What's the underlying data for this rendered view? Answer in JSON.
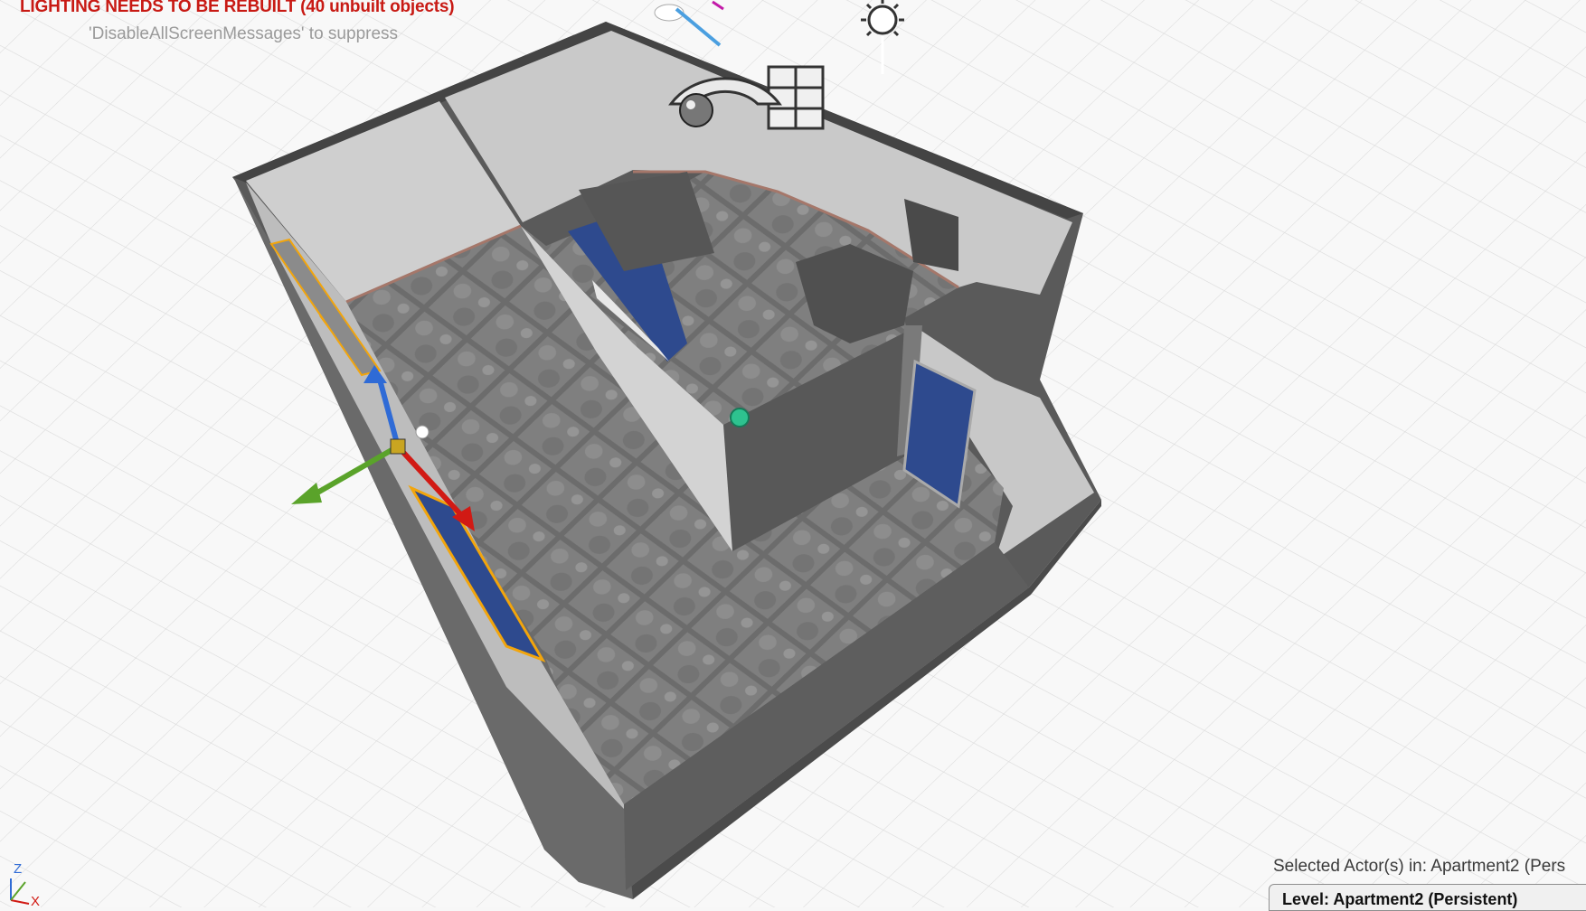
{
  "viewport": {
    "warning_message": "LIGHTING NEEDS TO BE REBUILT (40 unbuilt objects)",
    "hint_message": "'DisableAllScreenMessages' to suppress",
    "axis_labels": {
      "z": "Z",
      "x": "X"
    },
    "icons": [
      "grid-background",
      "directional-light-icon",
      "sky-sphere-icon",
      "reflection-capture-icon",
      "transform-gizmo",
      "player-start-icon"
    ],
    "colors": {
      "warning": "#c81a14",
      "selection": "#f2a50c",
      "door": "#2e4a8e",
      "gizmo_x": "#d11a14",
      "gizmo_y": "#5aa32a",
      "gizmo_z": "#2f6bd6"
    }
  },
  "status": {
    "selected_label": "Selected Actor(s) in:",
    "selected_value": "Apartment2 (Pers",
    "level_label": "Level:",
    "level_value": "Apartment2 (Persistent)"
  }
}
